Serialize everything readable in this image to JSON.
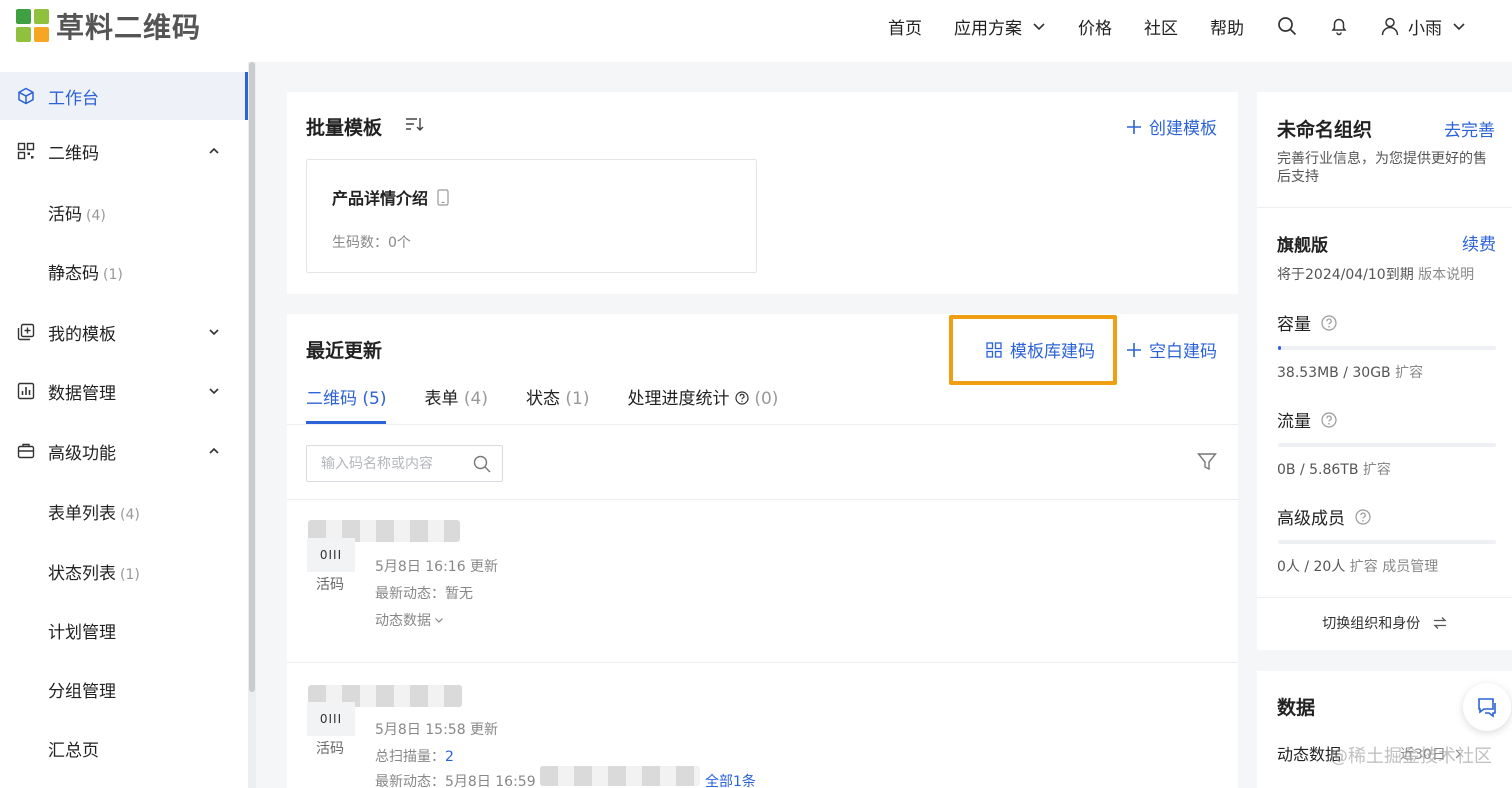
{
  "brand": {
    "name": "草料二维码",
    "colors": [
      "#3ea040",
      "#8fc13e",
      "#f5a623",
      "#49b8e6"
    ]
  },
  "nav": {
    "items": [
      "首页",
      "应用方案",
      "价格",
      "社区",
      "帮助"
    ],
    "user": "小雨"
  },
  "sidebar": {
    "workbench": "工作台",
    "qrcode": "二维码",
    "live_code": {
      "label": "活码",
      "count": "(4)"
    },
    "static_code": {
      "label": "静态码",
      "count": "(1)"
    },
    "my_templates": "我的模板",
    "data_mgmt": "数据管理",
    "advanced": "高级功能",
    "form_list": {
      "label": "表单列表",
      "count": "(4)"
    },
    "status_list": {
      "label": "状态列表",
      "count": "(1)"
    },
    "plan_mgmt": "计划管理",
    "group_mgmt": "分组管理",
    "summary": "汇总页"
  },
  "batch": {
    "title": "批量模板",
    "create_label": "创建模板",
    "template_name": "产品详情介绍",
    "gen_count": "生码数：0个"
  },
  "recent": {
    "title": "最近更新",
    "from_library": "模板库建码",
    "blank": "空白建码",
    "tabs": [
      {
        "label": "二维码",
        "count": "(5)"
      },
      {
        "label": "表单",
        "count": "(4)"
      },
      {
        "label": "状态",
        "count": "(1)"
      },
      {
        "label": "处理进度统计",
        "count": "(0)"
      }
    ],
    "search_placeholder": "输入码名称或内容",
    "rows": [
      {
        "thumb": "0III",
        "type": "活码",
        "updated": "5月8日 16:16 更新",
        "line2": "最新动态：暂无",
        "line3": "动态数据"
      },
      {
        "thumb": "0III",
        "type": "活码",
        "updated": "5月8日 15:58 更新",
        "scan_label": "总扫描量：",
        "scan_value": "2",
        "line3": "最新动态：5月8日 16:59",
        "all_link": "全部1条"
      }
    ]
  },
  "org": {
    "name": "未命名组织",
    "complete": "去完善",
    "desc": "完善行业信息，为您提供更好的售后支持",
    "plan": "旗舰版",
    "renew": "续费",
    "expiry": "将于2024/04/10到期",
    "version_note": "版本说明",
    "capacity_label": "容量",
    "capacity_value": "38.53MB / 30GB",
    "capacity_expand": "扩容",
    "capacity_progress": 0.013,
    "traffic_label": "流量",
    "traffic_value": "0B / 5.86TB",
    "traffic_expand": "扩容",
    "traffic_progress": 0,
    "members_label": "高级成员",
    "members_value": "0人 / 20人",
    "members_expand": "扩容",
    "members_manage": "成员管理",
    "members_progress": 0,
    "switch": "切换组织和身份"
  },
  "data_card": {
    "title": "数据",
    "dynamic": "动态数据",
    "period": "近30日"
  },
  "watermark": "@稀土掘金技术社区"
}
